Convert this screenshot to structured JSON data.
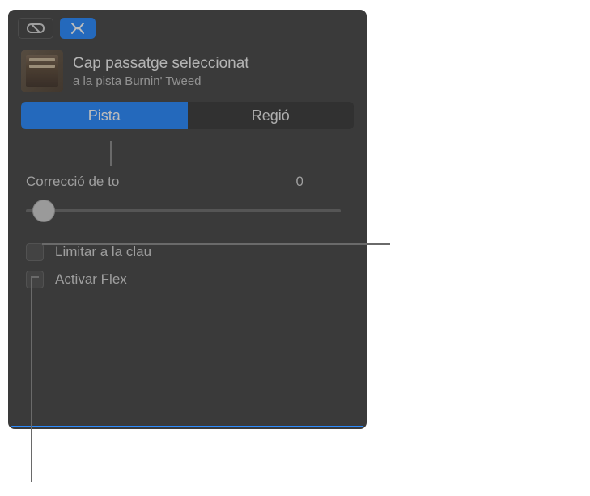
{
  "header": {
    "title": "Cap passatge seleccionat",
    "subtitle": "a la pista Burnin' Tweed"
  },
  "tabs": {
    "track": "Pista",
    "region": "Regió"
  },
  "pitch": {
    "label": "Correcció de to",
    "value": "0"
  },
  "checkboxes": {
    "limit_to_key": "Limitar a la clau",
    "enable_flex": "Activar Flex"
  }
}
